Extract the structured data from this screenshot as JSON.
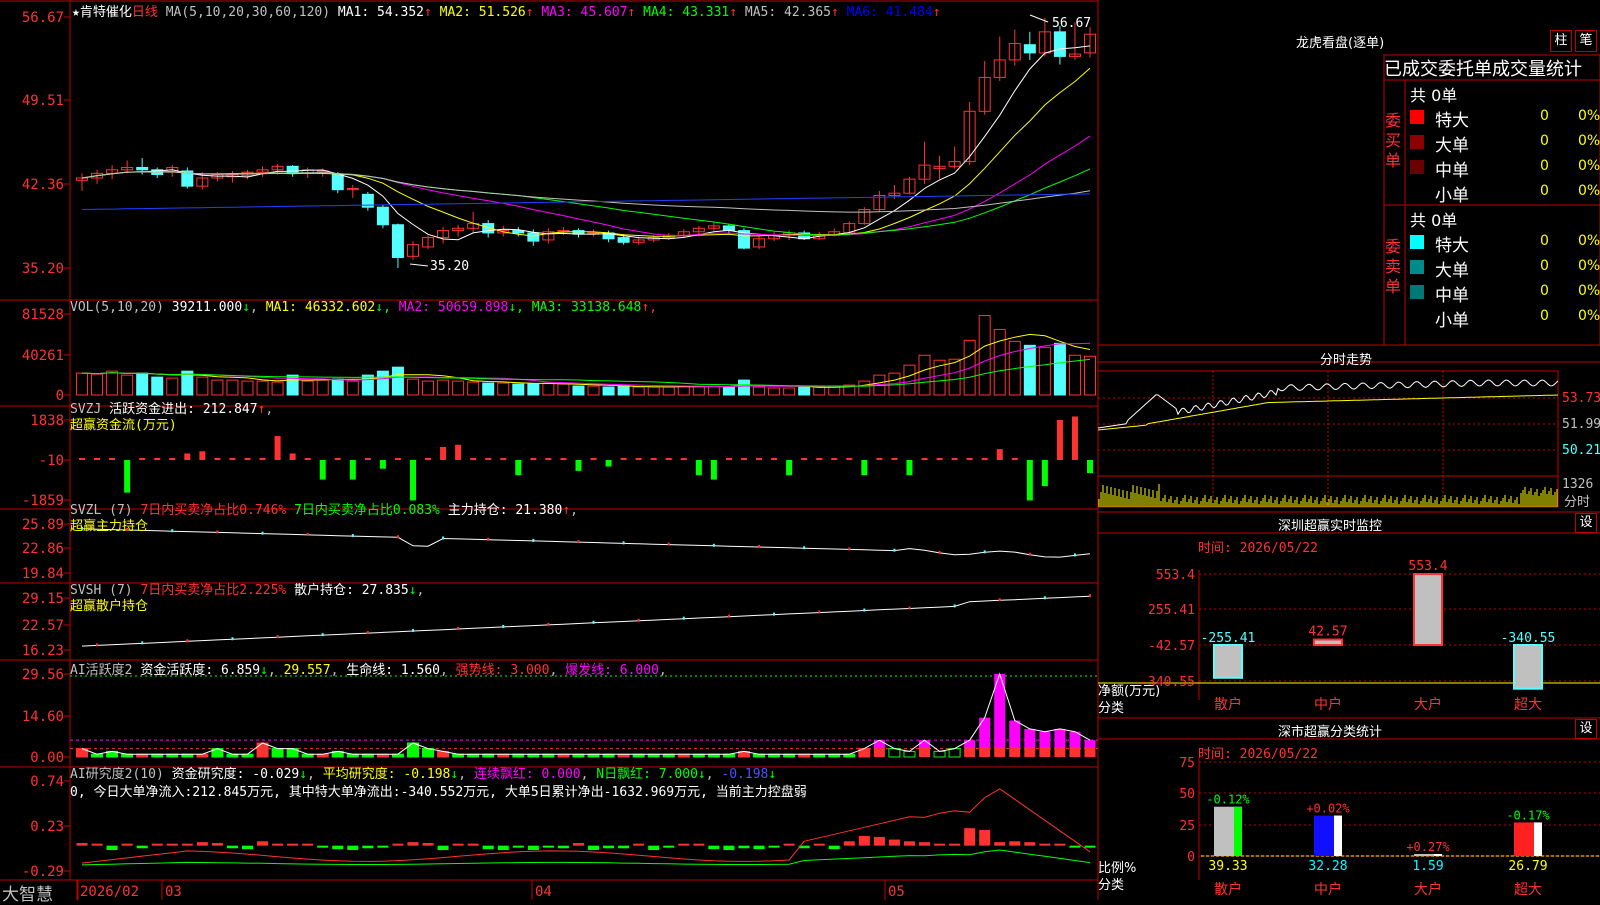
{
  "header": {
    "star": "★",
    "stock_name": "肯特催化",
    "period": "日线",
    "ma_label": "MA(5,10,20,30,60,120)",
    "ma_items": [
      {
        "name": "MA1:",
        "value": "54.352",
        "arrow": "↑",
        "color": "#ffffff"
      },
      {
        "name": "MA2:",
        "value": "51.526",
        "arrow": "↑",
        "color": "#ffff00"
      },
      {
        "name": "MA3:",
        "value": "45.607",
        "arrow": "↑",
        "color": "#ff00ff"
      },
      {
        "name": "MA4:",
        "value": "43.331",
        "arrow": "↑",
        "color": "#00ff00"
      },
      {
        "name": "MA5:",
        "value": "42.365",
        "arrow": "↑",
        "color": "#c0c0c0"
      },
      {
        "name": "MA6:",
        "value": "41.484",
        "arrow": "↑",
        "color": "#0000ff"
      }
    ]
  },
  "price_axis": [
    "56.67",
    "49.51",
    "42.36",
    "35.20"
  ],
  "price_high_label": "56.67",
  "price_low_label": "35.20",
  "vol_panel": {
    "label": "VOL(5,10,20)",
    "value": "39211.000",
    "arrow": "↓",
    "ma": [
      {
        "name": "MA1:",
        "value": "46332.602",
        "arrow": "↓",
        "color": "#ffff00"
      },
      {
        "name": "MA2:",
        "value": "50659.898",
        "arrow": "↓",
        "color": "#ff00ff"
      },
      {
        "name": "MA3:",
        "value": "33138.648",
        "arrow": "↑",
        "color": "#00ff00"
      }
    ],
    "axis": [
      "81528",
      "40261",
      "0"
    ]
  },
  "svzj_panel": {
    "label": "SVZJ",
    "text1": "活跃资金进出:",
    "value": "212.847",
    "arrow": "↑",
    "text2": "超赢资金流(万元)",
    "axis": [
      "1838",
      "-10",
      "-1859"
    ]
  },
  "svzl_panel": {
    "label": "SVZL (7)",
    "t1": "7日内买卖净占比0.746%",
    "t2": "7日内买卖净占比0.083%",
    "t3": "主力持仓:",
    "value": "21.380",
    "arrow": "↑",
    "sub": "超赢主力持仓",
    "axis": [
      "25.89",
      "22.86",
      "19.84"
    ]
  },
  "svsh_panel": {
    "label": "SVSH (7)",
    "t1": "7日内买卖净占比2.225%",
    "t2": "散户持仓:",
    "value": "27.835",
    "arrow": "↓",
    "sub": "超赢散户持仓",
    "axis": [
      "29.15",
      "22.57",
      "16.23"
    ]
  },
  "ai_active_panel": {
    "label": "AI活跃度2",
    "t1": "资金活跃度:",
    "v1": "6.859",
    "a1": "↓",
    "v2": "29.557",
    "t3": "生命线:",
    "v3": "1.560",
    "t4": "强势线:",
    "v4": "3.000",
    "t5": "爆发线:",
    "v5": "6.000",
    "axis": [
      "29.56",
      "14.60",
      "0.00"
    ]
  },
  "ai_research_panel": {
    "label": "AI研究度2(10)",
    "t1": "资金研究度:",
    "v1": "-0.029",
    "a1": "↓",
    "t2": "平均研究度:",
    "v2": "-0.198",
    "a2": "↓",
    "t3": "连续飘红:",
    "v3": "0.000",
    "t4": "N日飘红:",
    "v4": "7.000",
    "a4": "↓",
    "v5": "-0.198",
    "a5": "↓",
    "summary": "0, 今日大单净流入:212.845万元, 其中特大单净流出:-340.552万元, 大单5日累计净出-1632.969万元, 当前主力控盘弱",
    "axis": [
      "0.74",
      "0.23",
      "-0.29"
    ]
  },
  "bottom_bar": {
    "brand": "大智慧",
    "dates": [
      "2026/02",
      "03",
      "04",
      "05"
    ]
  },
  "right_panel": {
    "title": "龙虎看盘(逐单)",
    "btn_zhu": "柱",
    "btn_bi": "笔",
    "stats_title": "已成交委托单成交量统计",
    "buy": {
      "label": "委买单",
      "total": "共 0单",
      "rows": [
        {
          "name": "特大",
          "count": "0",
          "pct": "0%",
          "color": "#ff0000"
        },
        {
          "name": "大单",
          "count": "0",
          "pct": "0%",
          "color": "#8b0000"
        },
        {
          "name": "中单",
          "count": "0",
          "pct": "0%",
          "color": "#6b0000"
        },
        {
          "name": "小单",
          "count": "0",
          "pct": "0%",
          "color": ""
        }
      ]
    },
    "sell": {
      "label": "委卖单",
      "total": "共 0单",
      "rows": [
        {
          "name": "特大",
          "count": "0",
          "pct": "0%",
          "color": "#00ffff"
        },
        {
          "name": "大单",
          "count": "0",
          "pct": "0%",
          "color": "#008b8b"
        },
        {
          "name": "中单",
          "count": "0",
          "pct": "0%",
          "color": "#007777"
        },
        {
          "name": "小单",
          "count": "0",
          "pct": "0%",
          "color": ""
        }
      ]
    },
    "intraday": {
      "title": "分时走势",
      "axis": [
        "53.73",
        "51.99",
        "50.21"
      ],
      "vol_label": "1326",
      "sub_label": "分时"
    },
    "monitor": {
      "title": "深圳超赢实时监控",
      "set_btn": "设",
      "time": "时间: 2026/05/22",
      "axis": [
        "553.4",
        "255.41",
        "-42.57",
        "-340.55"
      ],
      "left_label1": "净额(万元)",
      "left_label2": "分类",
      "bars": [
        {
          "cat": "散户",
          "value": -255.41,
          "label": "-255.41"
        },
        {
          "cat": "中户",
          "value": 42.57,
          "label": "42.57"
        },
        {
          "cat": "大户",
          "value": 553.4,
          "label": "553.4"
        },
        {
          "cat": "超大",
          "value": -340.55,
          "label": "-340.55"
        }
      ]
    },
    "classify": {
      "title": "深市超赢分类统计",
      "set_btn": "设",
      "time": "时间: 2026/05/22",
      "axis": [
        "75",
        "50",
        "25",
        "0"
      ],
      "left_label1": "比例%",
      "left_label2": "分类",
      "bars": [
        {
          "cat": "散户",
          "value": 39.33,
          "label": "39.33",
          "chg": "-0.12%",
          "chg_color": "#00ff00",
          "fill": "#c0c0c0",
          "accent": "#00ff00"
        },
        {
          "cat": "中户",
          "value": 32.28,
          "label": "32.28",
          "chg": "+0.02%",
          "chg_color": "#ff3030",
          "fill": "#1010ff",
          "accent": "#ffffff"
        },
        {
          "cat": "大户",
          "value": 1.59,
          "label": "1.59",
          "chg": "+0.27%",
          "chg_color": "#ff3030",
          "fill": "#c0c0c0",
          "accent": "#ffffff"
        },
        {
          "cat": "超大",
          "value": 26.79,
          "label": "26.79",
          "chg": "-0.17%",
          "chg_color": "#00ff00",
          "fill": "#ff2020",
          "accent": "#ffffff"
        }
      ]
    }
  },
  "colors": {
    "up": "#ff3232",
    "down": "#54ffff",
    "grid": "#c00000",
    "axis_text": "#ff3232"
  }
}
